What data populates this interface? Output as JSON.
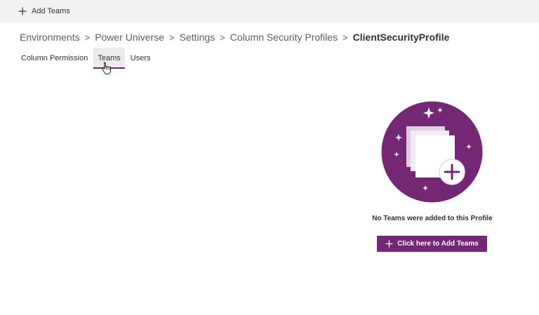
{
  "command_bar": {
    "add_label": "Add Teams",
    "add_icon": "plus-icon"
  },
  "breadcrumb": {
    "items": [
      "Environments",
      "Power Universe",
      "Settings",
      "Column Security Profiles"
    ],
    "current": "ClientSecurityProfile",
    "separator": ">"
  },
  "tabs": [
    {
      "label": "Column Permission",
      "selected": false
    },
    {
      "label": "Teams",
      "selected": true
    },
    {
      "label": "Users",
      "selected": false
    }
  ],
  "empty_state": {
    "message": "No Teams were added to this Profile",
    "button_label": "Click here to Add Teams",
    "illustration_icon": "empty-teams-illustration"
  },
  "colors": {
    "accent": "#742774",
    "command_bar_bg": "#f3f2f1",
    "tab_selected_bg": "#edebe9"
  }
}
